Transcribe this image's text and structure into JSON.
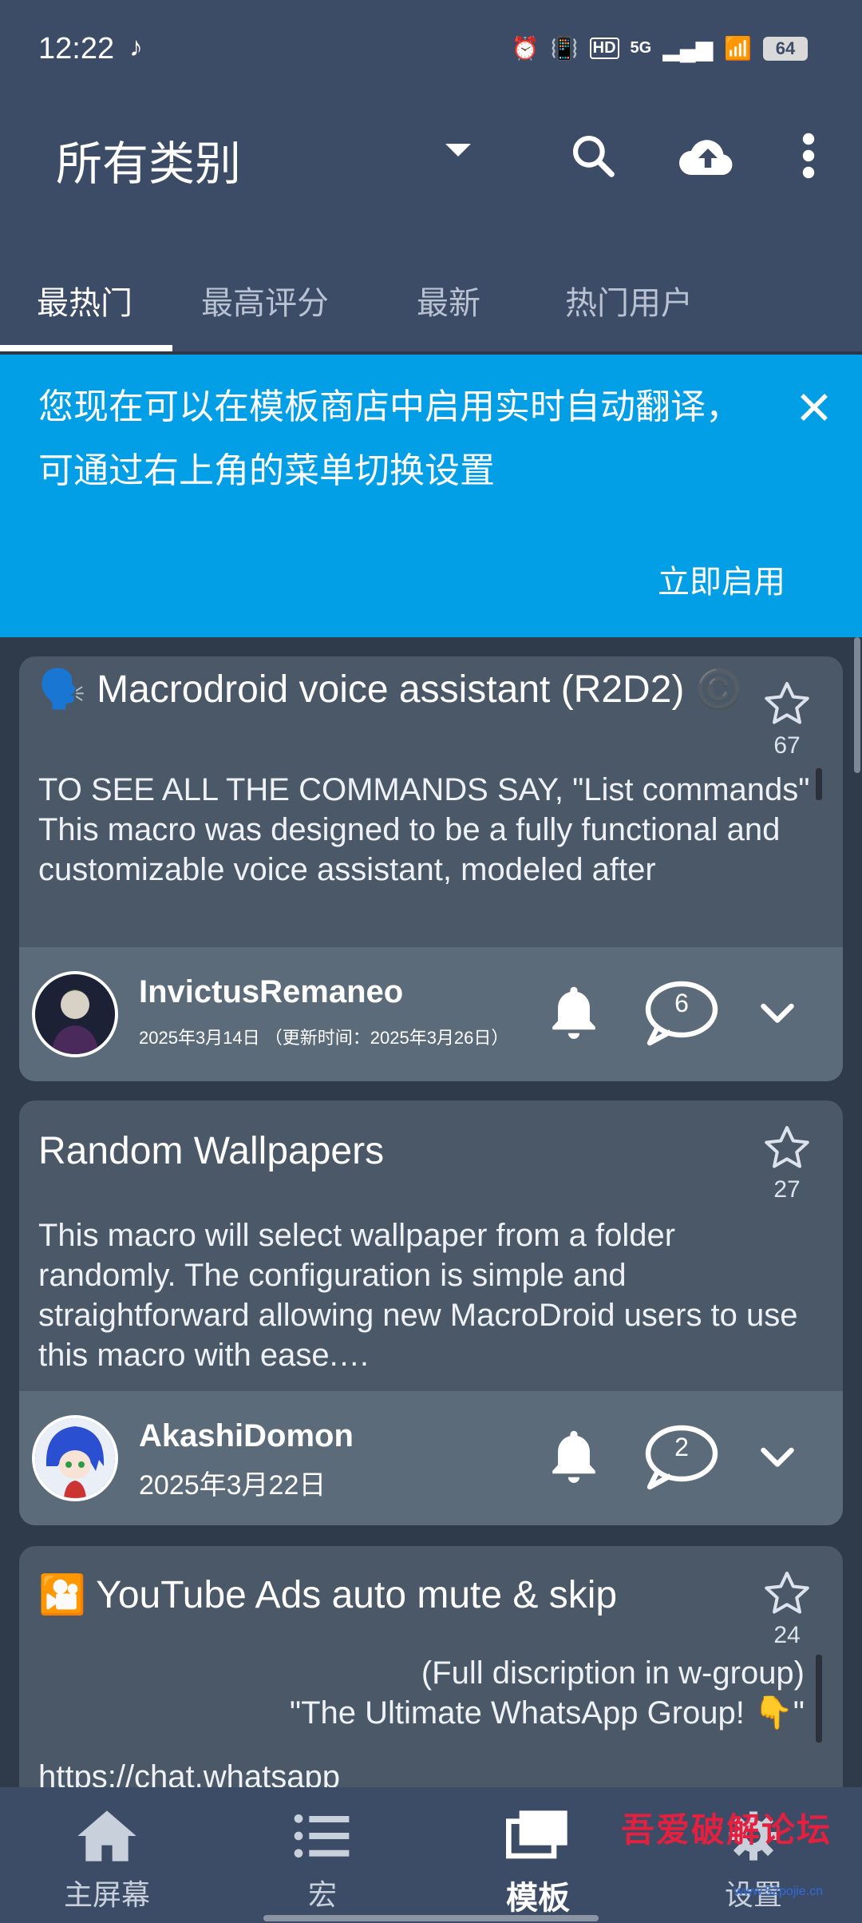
{
  "status_bar": {
    "time": "12:22",
    "network": "5G",
    "hd_label": "HD",
    "battery": "64"
  },
  "app_bar": {
    "title": "所有类别",
    "icons": [
      "search-icon",
      "cloud-upload-icon",
      "more-vert-icon"
    ]
  },
  "tabs": [
    {
      "label": "最热门",
      "active": true
    },
    {
      "label": "最高评分",
      "active": false
    },
    {
      "label": "最新",
      "active": false
    },
    {
      "label": "热门用户",
      "active": false
    }
  ],
  "banner": {
    "message": "您现在可以在模板商店中启用实时自动翻译，可通过右上角的菜单切换设置",
    "action": "立即启用",
    "color": "#029ee6"
  },
  "cards": [
    {
      "emoji": "🗣️",
      "title": "Macrodroid voice assistant (R2D2)",
      "title_suffix": "©️",
      "stars": "67",
      "description": "TO SEE ALL THE COMMANDS SAY, \"List commands\"\nThis macro was designed to be a fully functional and customizable voice assistant, modeled after",
      "user": "InvictusRemaneo",
      "date": "2025年3月14日 （更新时间：2025年3月26日）",
      "comments": "6"
    },
    {
      "emoji": "",
      "title": "Random Wallpapers",
      "title_suffix": "",
      "stars": "27",
      "description": "This macro will select wallpaper from a folder randomly. The configuration is simple and straightforward allowing new MacroDroid users to use this macro with ease.…",
      "user": "AkashiDomon",
      "date": "2025年3月22日",
      "comments": "2"
    },
    {
      "emoji": "🎦",
      "title": "YouTube Ads auto mute & skip",
      "title_suffix": "",
      "stars": "24",
      "description_line1": "(Full discription in w-group)",
      "description_line2": "\"The Ultimate WhatsApp Group! 👇\"",
      "description_line3": "https://chat.whatsapp"
    }
  ],
  "bottom_nav": [
    {
      "label": "主屏幕",
      "icon": "home-icon",
      "active": false
    },
    {
      "label": "宏",
      "icon": "list-icon",
      "active": false
    },
    {
      "label": "模板",
      "icon": "templates-icon",
      "active": true
    },
    {
      "label": "设置",
      "icon": "gear-icon",
      "active": false
    }
  ],
  "watermark": {
    "text": "吾爱破解论坛",
    "url": "www.52pojie.cn"
  }
}
